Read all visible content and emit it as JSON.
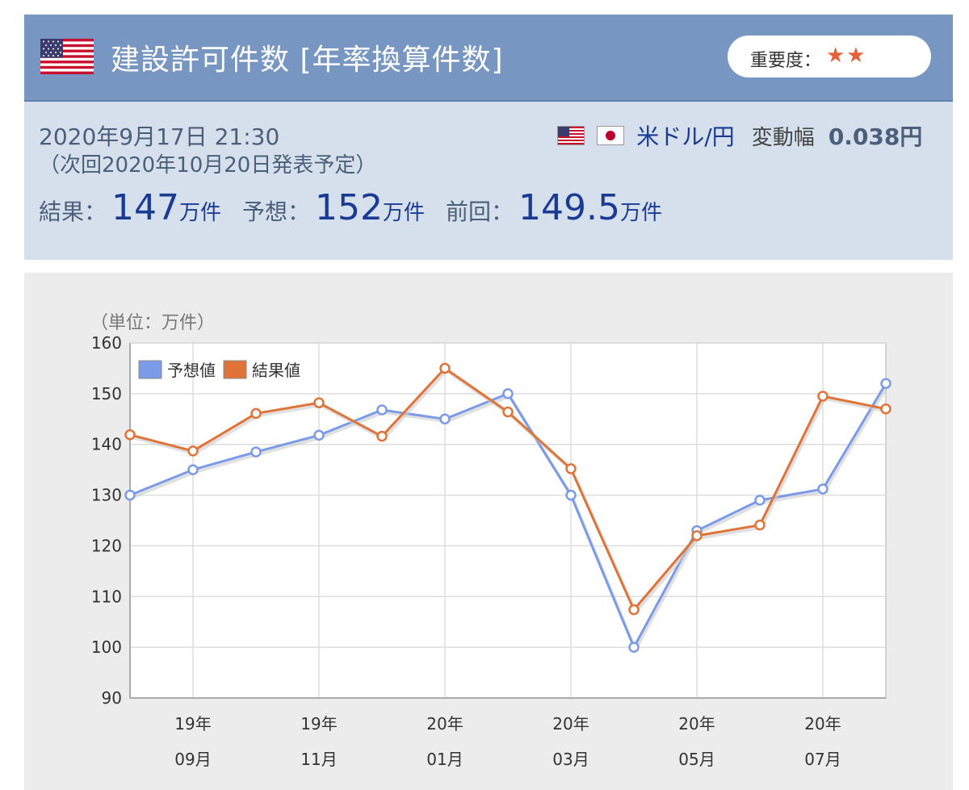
{
  "header": {
    "title": "建設許可件数 [年率換算件数]",
    "importance_label": "重要度：",
    "stars": "★★"
  },
  "info": {
    "date": "2020年9月17日 21:30",
    "next": "（次回2020年10月20日発表予定）",
    "pair": "米ドル/円",
    "fluct_label": "変動幅",
    "fluct_value": "0.038円",
    "result_label": "結果：",
    "result_value": "147",
    "forecast_label": "予想：",
    "forecast_value": "152",
    "previous_label": "前回：",
    "previous_value": "149.5",
    "unit": "万件"
  },
  "chart_unit_label": "（単位：万件）",
  "colors": {
    "header_bg": "#7797c2",
    "info_bg": "#d6e0ec",
    "forecast_line": "#7b9be8",
    "result_line": "#e07438",
    "star": "#e8603a"
  },
  "chart_data": {
    "type": "line",
    "ylim": [
      90,
      160
    ],
    "yticks": [
      90,
      100,
      110,
      120,
      130,
      140,
      150,
      160
    ],
    "x_labels": [
      {
        "index": 1,
        "line1": "19年",
        "line2": "09月"
      },
      {
        "index": 3,
        "line1": "19年",
        "line2": "11月"
      },
      {
        "index": 5,
        "line1": "20年",
        "line2": "01月"
      },
      {
        "index": 7,
        "line1": "20年",
        "line2": "03月"
      },
      {
        "index": 9,
        "line1": "20年",
        "line2": "05月"
      },
      {
        "index": 11,
        "line1": "20年",
        "line2": "07月"
      }
    ],
    "grid": true,
    "legend_position": "top-left",
    "series": [
      {
        "name": "予想値",
        "color": "#7b9be8",
        "values": [
          130,
          135,
          138.5,
          141.8,
          146.8,
          145,
          150,
          130,
          100,
          123,
          129,
          131.2,
          152
        ]
      },
      {
        "name": "結果値",
        "color": "#e07438",
        "values": [
          141.9,
          138.7,
          146.1,
          148.2,
          141.6,
          155,
          146.4,
          135.2,
          107.4,
          122,
          124.1,
          149.5,
          147
        ]
      }
    ]
  }
}
